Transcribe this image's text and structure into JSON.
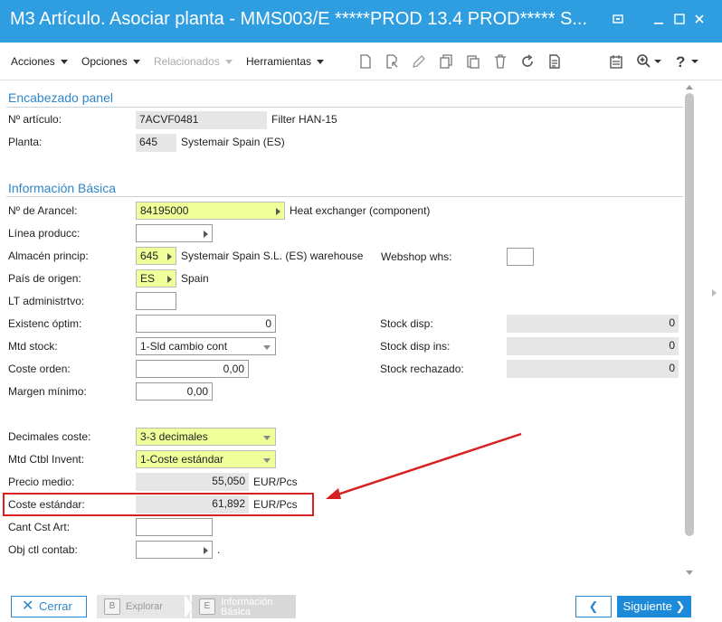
{
  "window": {
    "title": "M3 Artículo. Asociar planta - MMS003/E    *****PROD 13.4 PROD***** S..."
  },
  "toolbar": {
    "menus": [
      "Acciones",
      "Opciones",
      "Relacionados",
      "Herramientas"
    ],
    "icons": [
      "new-icon",
      "open-icon",
      "edit-icon",
      "copy-icon",
      "duplicate-icon",
      "delete-icon",
      "refresh-icon",
      "document-icon",
      "calendar-icon",
      "zoom-icon",
      "help-icon"
    ]
  },
  "header_panel": {
    "title": "Encabezado panel",
    "articulo_label": "Nº artículo:",
    "articulo_value": "7ACVF0481",
    "articulo_desc": "Filter HAN-15",
    "planta_label": "Planta:",
    "planta_value": "645",
    "planta_desc": "Systemair Spain (ES)"
  },
  "basic": {
    "title": "Información Básica",
    "arancel_label": "Nº de Arancel:",
    "arancel_value": "84195000",
    "arancel_desc": "Heat exchanger (component)",
    "linea_label": "Línea producc:",
    "linea_value": "",
    "almacen_label": "Almacén princip:",
    "almacen_value": "645",
    "almacen_desc": "Systemair Spain S.L. (ES) warehouse",
    "webshop_label": "Webshop whs:",
    "webshop_value": "",
    "pais_label": "País de origen:",
    "pais_value": "ES",
    "pais_desc": "Spain",
    "lt_label": "LT administrtvo:",
    "lt_value": "",
    "existenc_label": "Existenc óptim:",
    "existenc_value": "0",
    "stock_disp_label": "Stock disp:",
    "stock_disp_value": "0",
    "mtd_stock_label": "Mtd stock:",
    "mtd_stock_value": "1-Sld cambio cont",
    "stock_disp_ins_label": "Stock disp ins:",
    "stock_disp_ins_value": "0",
    "coste_orden_label": "Coste orden:",
    "coste_orden_value": "0,00",
    "stock_rech_label": "Stock rechazado:",
    "stock_rech_value": "0",
    "margen_label": "Margen mínimo:",
    "margen_value": "0,00",
    "decimales_label": "Decimales coste:",
    "decimales_value": "3-3 decimales",
    "mtd_ctbl_label": "Mtd Ctbl Invent:",
    "mtd_ctbl_value": "1-Coste estándar",
    "precio_medio_label": "Precio medio:",
    "precio_medio_value": "55,050",
    "precio_medio_unit": "EUR/Pcs",
    "coste_std_label": "Coste estándar:",
    "coste_std_value": "61,892",
    "coste_std_unit": "EUR/Pcs",
    "cant_cst_label": "Cant Cst Art:",
    "cant_cst_value": "",
    "obj_ctl_label": "Obj ctl contab:",
    "obj_ctl_value": "",
    "obj_ctl_suffix": "."
  },
  "footer": {
    "cerrar_label": "Cerrar",
    "step_explorar_key": "B",
    "step_explorar_label": "Explorar",
    "step_info_key": "E",
    "step_info_label_1": "Información",
    "step_info_label_2": "Básica",
    "siguiente_label": "Siguiente"
  },
  "colors": {
    "titlebar": "#2e9ee0",
    "section_title": "#2e86c8",
    "required_field": "#efff9a",
    "highlight_box": "#d82020",
    "annotation_arrow": "#d82020"
  }
}
